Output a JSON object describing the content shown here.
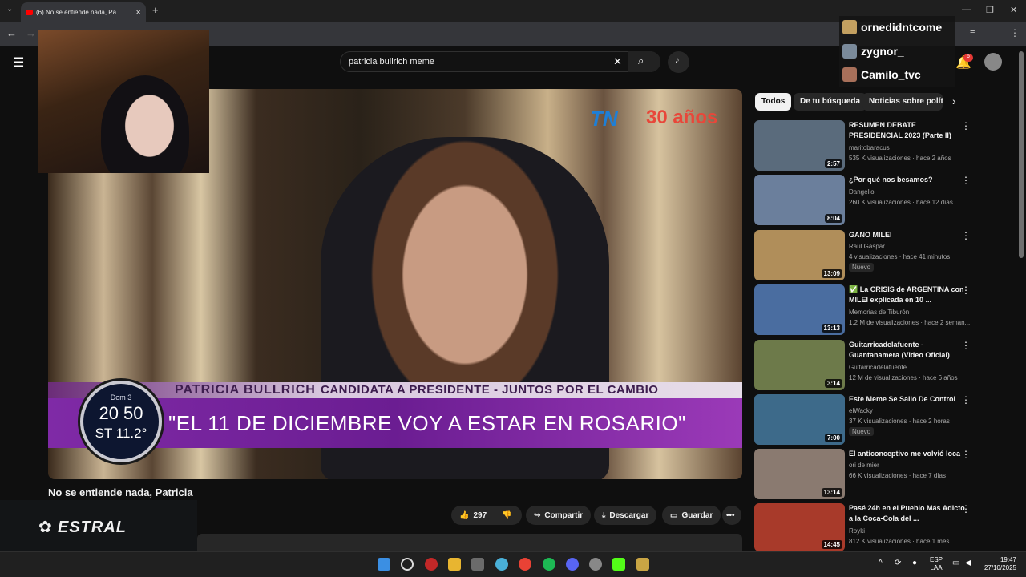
{
  "browser": {
    "tab_title": "(6) No se entiende nada, Pa",
    "new_tab": "+",
    "minimize": "—",
    "maximize": "❐",
    "close": "✕"
  },
  "youtube": {
    "search_value": "patricia bullrich meme",
    "notifications_count": "6"
  },
  "chat_overlay": {
    "users": [
      "ornedidntcome",
      "zygnor_",
      "Camilo_tvc"
    ]
  },
  "video": {
    "network_logo": "TN",
    "network_years": "30 años",
    "lower_third_name": "PATRICIA BULLRICH",
    "lower_third_role": "CANDIDATA A PRESIDENTE - JUNTOS POR EL CAMBIO",
    "quote": "\"EL 11 DE DICIEMBRE VOY A ESTAR EN ROSARIO\"",
    "clock_day": "Dom 3",
    "clock_time": "20 50",
    "clock_temp": "ST 11.2°",
    "title": "No se entiende nada, Patricia"
  },
  "actions": {
    "likes": "297",
    "share": "Compartir",
    "download": "Descargar",
    "save": "Guardar",
    "more": "•••"
  },
  "overlay_brand": "ESTRAL",
  "chips": [
    "Todos",
    "De tu búsqueda",
    "Noticias sobre política"
  ],
  "recommendations": [
    {
      "title": "RESUMEN DEBATE PRESIDENCIAL 2023 (Parte II)",
      "channel": "maritobaracus",
      "meta": "535 K visualizaciones · hace 2 años",
      "duration": "2:57",
      "badge": "",
      "thumb_color": "#5a6b7c"
    },
    {
      "title": "¿Por qué nos besamos?",
      "channel": "Dangello",
      "meta": "260 K visualizaciones · hace 12 días",
      "duration": "8:04",
      "badge": "",
      "thumb_color": "#6b7f9c"
    },
    {
      "title": "GANO MILEI",
      "channel": "Raul Gaspar",
      "meta": "4 visualizaciones · hace 41 minutos",
      "duration": "13:09",
      "badge": "Nuevo",
      "thumb_color": "#b08e5a"
    },
    {
      "title": "✅ La CRISIS de ARGENTINA con MILEI explicada en 10 ...",
      "channel": "Memorias de Tiburón",
      "meta": "1,2 M de visualizaciones · hace 2 seman...",
      "duration": "13:13",
      "badge": "",
      "thumb_color": "#4a6da0"
    },
    {
      "title": "Guitarricadelafuente - Guantanamera (Video Oficial)",
      "channel": "Guitarricadelafuente",
      "meta": "12 M de visualizaciones · hace 6 años",
      "duration": "3:14",
      "badge": "",
      "thumb_color": "#6d7a4a"
    },
    {
      "title": "Este Meme Se Salió De Control",
      "channel": "elWacky",
      "meta": "37 K visualizaciones · hace 2 horas",
      "duration": "7:00",
      "badge": "Nuevo",
      "thumb_color": "#3d6a8a"
    },
    {
      "title": "El anticonceptivo me volvió loca",
      "channel": "ori de mier",
      "meta": "66 K visualizaciones · hace 7 días",
      "duration": "13:14",
      "badge": "",
      "thumb_color": "#8a7a70"
    },
    {
      "title": "Pasé 24h en el Pueblo Más Adicto a la Coca-Cola del ...",
      "channel": "Royki",
      "meta": "812 K visualizaciones · hace 1 mes",
      "duration": "14:45",
      "badge": "",
      "thumb_color": "#a83a2a"
    }
  ],
  "taskbar": {
    "lang_top": "ESP",
    "lang_bottom": "LAA",
    "time": "19:47",
    "date": "27/10/2025"
  }
}
